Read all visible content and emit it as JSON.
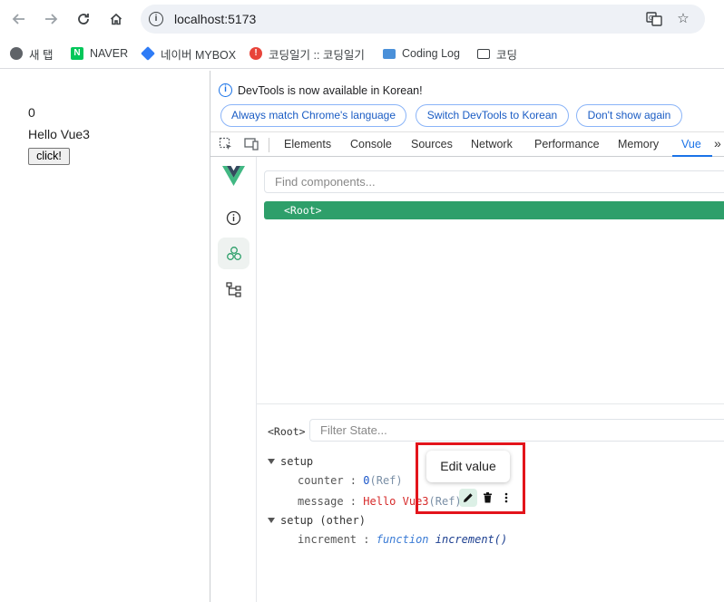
{
  "browser": {
    "url": "localhost:5173",
    "bookmarks": [
      {
        "label": "새 탭",
        "icon": "globe-icon",
        "color": "#5f6368"
      },
      {
        "label": "NAVER",
        "icon": "naver-icon",
        "color": "#03c75a"
      },
      {
        "label": "네이버 MYBOX",
        "icon": "mybox-icon",
        "color": "#2f7cf6"
      },
      {
        "label": "코딩일기 :: 코딩일기",
        "icon": "blog-icon",
        "color": "#e8443a"
      },
      {
        "label": "Coding Log",
        "icon": "monitor-icon",
        "color": "#4a90d9"
      },
      {
        "label": "코딩",
        "icon": "folder-icon",
        "color": "#3c4043"
      }
    ]
  },
  "page": {
    "counter": "0",
    "message": "Hello Vue3",
    "button_label": "click!"
  },
  "devtools": {
    "info_text": "DevTools is now available in Korean!",
    "info_buttons": [
      "Always match Chrome's language",
      "Switch DevTools to Korean",
      "Don't show again"
    ],
    "tabs": [
      "Elements",
      "Console",
      "Sources",
      "Network",
      "Performance",
      "Memory",
      "Vue"
    ],
    "more_tabs": "»",
    "active_tab": "Vue"
  },
  "vue": {
    "find_placeholder": "Find components...",
    "root_component": "<Root>",
    "state_root": "<Root>",
    "filter_placeholder": "Filter State...",
    "sections": [
      {
        "name": "setup",
        "items": [
          {
            "key": "counter",
            "value": "0",
            "type": "(Ref)"
          },
          {
            "key": "message",
            "value": "Hello Vue3",
            "type": "(Ref)"
          }
        ]
      },
      {
        "name": "setup (other)",
        "items": [
          {
            "key": "increment",
            "fn_keyword": "function",
            "fn_name": "increment()"
          }
        ]
      }
    ],
    "tooltip": "Edit value",
    "accent": "#2e9f6a",
    "highlight_color": "#e3141b"
  }
}
